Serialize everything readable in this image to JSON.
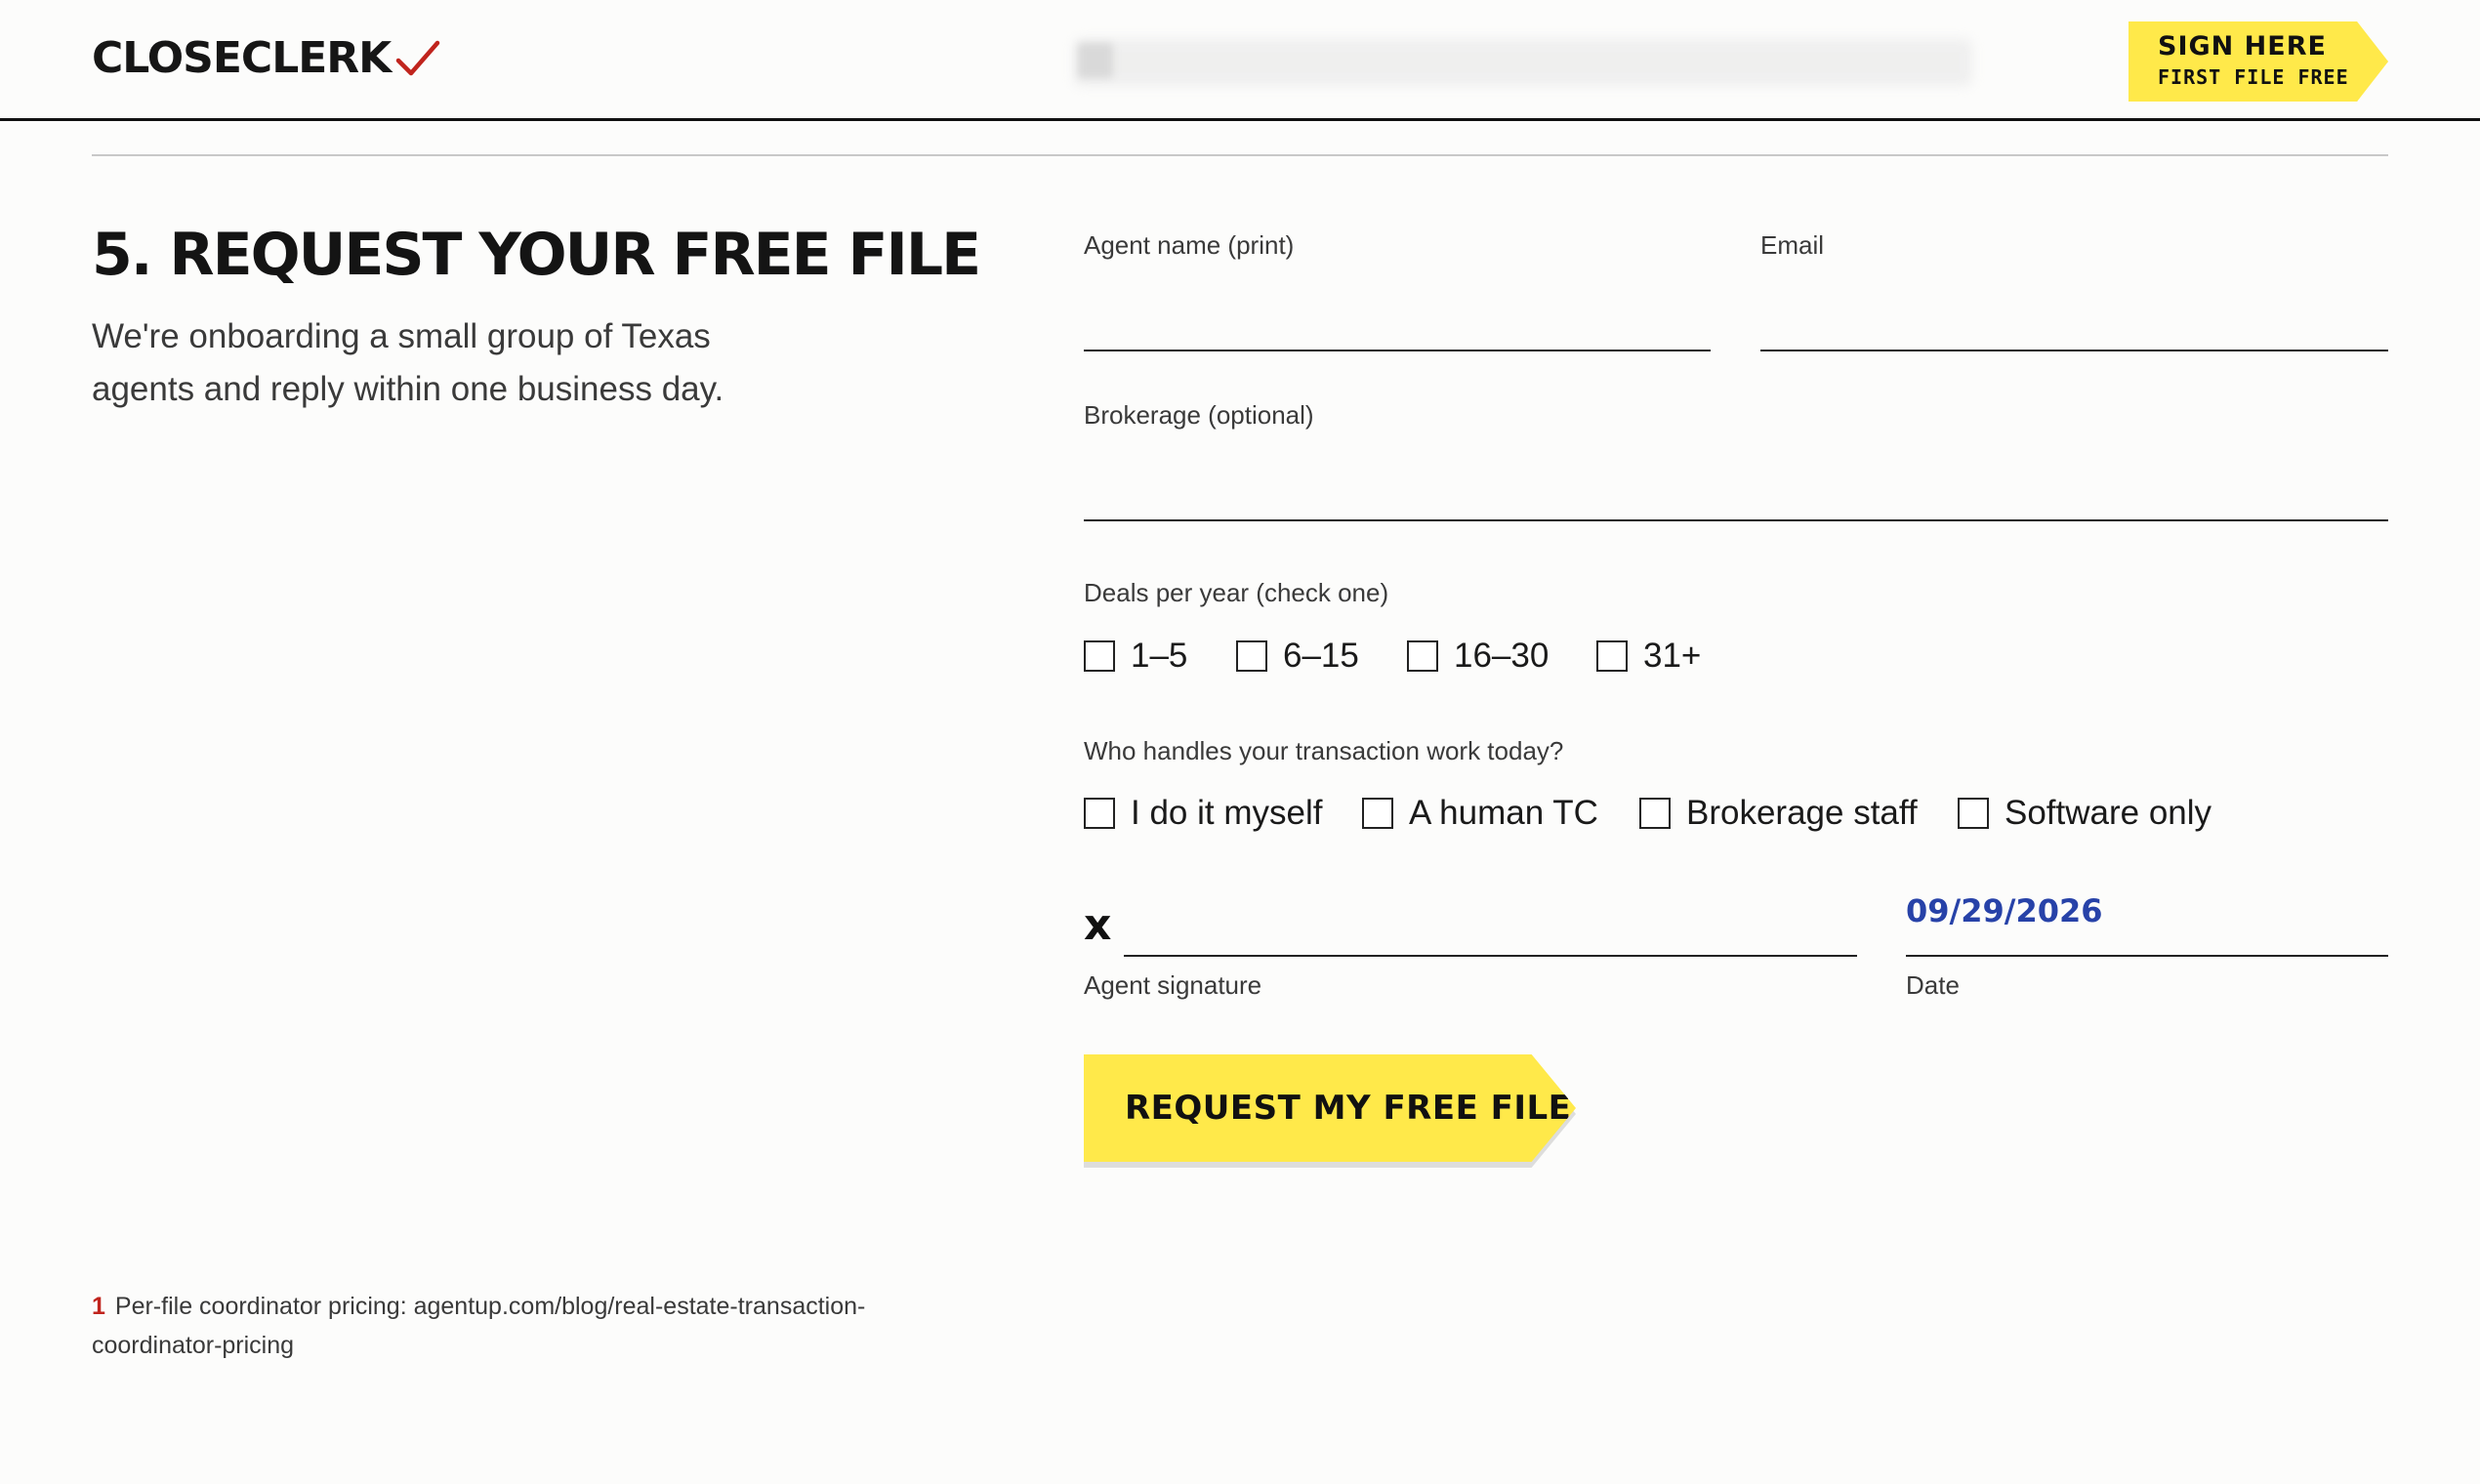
{
  "header": {
    "logo_text": "CLOSECLERK",
    "logo_icon": "checkmark-icon",
    "sign_button": {
      "title": "SIGN HERE",
      "subtitle": "FIRST FILE FREE"
    }
  },
  "section": {
    "title": "5.  REQUEST YOUR FREE FILE",
    "intro": "We're onboarding a small group of Texas agents and reply within one business day."
  },
  "form": {
    "agent_name_label": "Agent name (print)",
    "agent_name_value": "",
    "email_label": "Email",
    "email_value": "",
    "brokerage_label": "Brokerage (optional)",
    "brokerage_value": "",
    "deals_label": "Deals per year (check one)",
    "deals_options": [
      "1–5",
      "6–15",
      "16–30",
      "31+"
    ],
    "handles_label": "Who handles your transaction work today?",
    "handles_options": [
      "I do it myself",
      "A human TC",
      "Brokerage staff",
      "Software only"
    ],
    "signature_mark": "x",
    "signature_label": "Agent signature",
    "date_value": "09/29/2026",
    "date_label": "Date",
    "submit_label": "REQUEST MY FREE FILE"
  },
  "footnote": {
    "number": "1",
    "text": "Per-file coordinator pricing: agentup.com/blog/real-estate-transaction-coordinator-pricing"
  },
  "colors": {
    "accent_yellow": "#ffe94a",
    "check_red": "#c0241d",
    "date_blue": "#2742a8",
    "ink": "#111111"
  }
}
